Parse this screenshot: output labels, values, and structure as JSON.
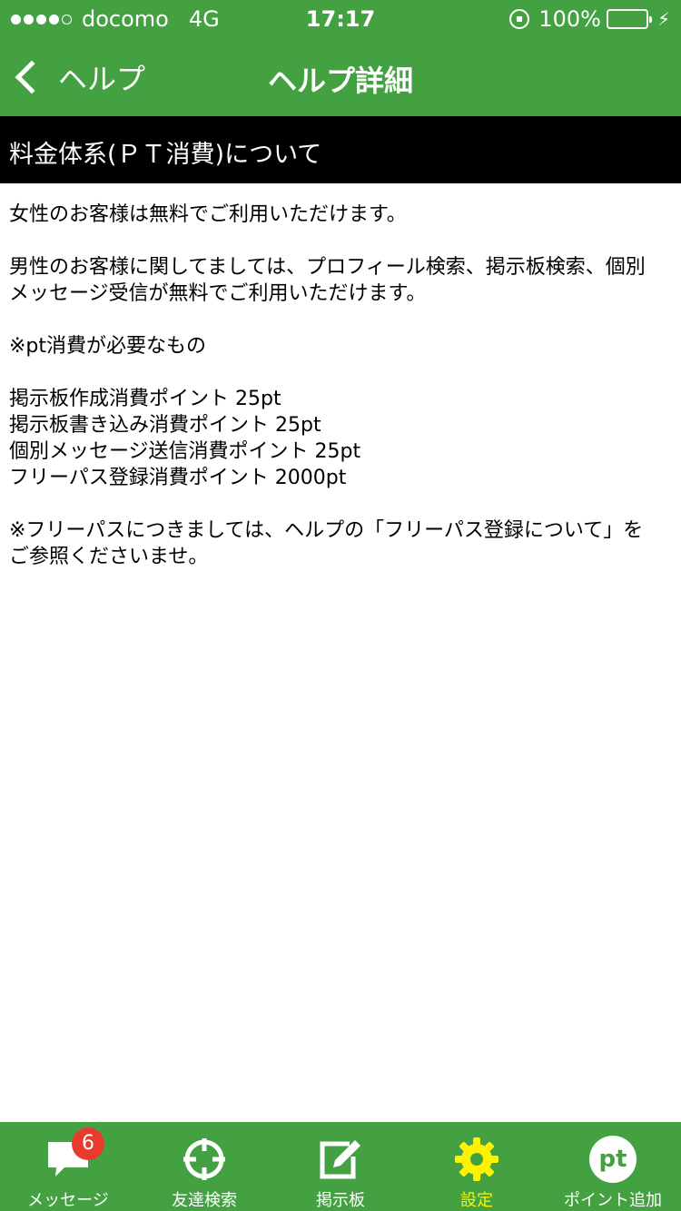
{
  "status_bar": {
    "carrier": "docomo",
    "network": "4G",
    "time": "17:17",
    "battery": "100%"
  },
  "nav": {
    "back_label": "ヘルプ",
    "title": "ヘルプ詳細"
  },
  "section": {
    "title": "料金体系(ＰＴ消費)について"
  },
  "content": {
    "lines": [
      "女性のお客様は無料でご利用いただけます。",
      "",
      "男性のお客様に関してましては、プロフィール検索、掲示板検索、個別",
      "メッセージ受信が無料でご利用いただけます。",
      "",
      "※pt消費が必要なもの",
      "",
      "掲示板作成消費ポイント  25pt",
      "掲示板書き込み消費ポイント  25pt",
      "個別メッセージ送信消費ポイント  25pt",
      "フリーパス登録消費ポイント 2000pt",
      "",
      "※フリーパスにつきましては、ヘルプの「フリーパス登録について」を",
      "ご参照くださいませ。"
    ]
  },
  "tabs": [
    {
      "label": "メッセージ",
      "icon": "message-icon",
      "badge": "6"
    },
    {
      "label": "友達検索",
      "icon": "crosshair-icon"
    },
    {
      "label": "掲示板",
      "icon": "edit-icon"
    },
    {
      "label": "設定",
      "icon": "gear-icon",
      "active": true
    },
    {
      "label": "ポイント追加",
      "icon": "pt-icon",
      "icon_text": "pt"
    }
  ],
  "colors": {
    "primary": "#43a142",
    "active_tab": "#fff200",
    "badge": "#e83a2f",
    "section_bg": "#000000"
  }
}
